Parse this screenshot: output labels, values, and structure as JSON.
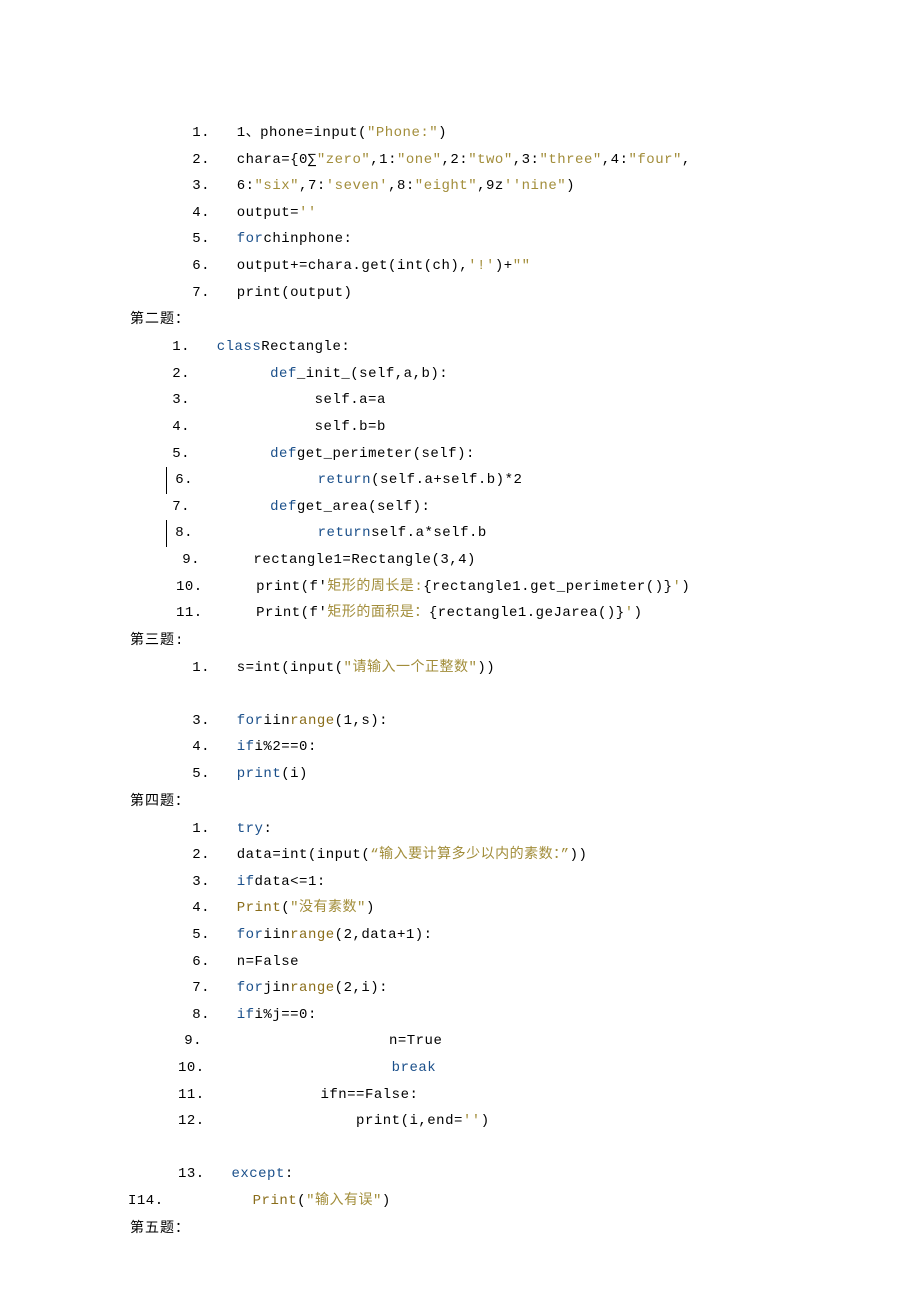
{
  "sections": [
    {
      "heading": null,
      "lines": [
        {
          "n": "1.",
          "indent": "ind0",
          "segs": [
            "1、phone=input(",
            {
              "cls": "str",
              "t": "\"Phone:\""
            },
            ")"
          ]
        },
        {
          "n": "2.",
          "indent": "ind0",
          "segs": [
            "chara={0∑",
            {
              "cls": "str",
              "t": "\"zero\""
            },
            ",1:",
            {
              "cls": "str",
              "t": "\"one\""
            },
            ",2:",
            {
              "cls": "str",
              "t": "\"two\""
            },
            ",3:",
            {
              "cls": "str",
              "t": "\"three\""
            },
            ",4:",
            {
              "cls": "str",
              "t": "\"four\""
            },
            ","
          ]
        },
        {
          "n": "3.",
          "indent": "ind0",
          "segs": [
            "6:",
            {
              "cls": "str",
              "t": "\"six\""
            },
            ",7:",
            {
              "cls": "str",
              "t": "'seven'"
            },
            ",8:",
            {
              "cls": "str",
              "t": "\"eight\""
            },
            ",9z",
            {
              "cls": "str",
              "t": "''nine\""
            },
            ")"
          ]
        },
        {
          "n": "4.",
          "indent": "ind0",
          "segs": [
            "output=",
            {
              "cls": "str",
              "t": "''"
            }
          ]
        },
        {
          "n": "5.",
          "indent": "ind0",
          "segs": [
            {
              "cls": "kw",
              "t": "for"
            },
            "chinphone:"
          ]
        },
        {
          "n": "6.",
          "indent": "ind0",
          "segs": [
            "output+=chara.get(int(ch),",
            {
              "cls": "str",
              "t": "'!'"
            },
            ")+",
            {
              "cls": "str",
              "t": "\"\""
            }
          ]
        },
        {
          "n": "7.",
          "indent": "ind0",
          "segs": [
            "print(output)"
          ]
        }
      ]
    },
    {
      "heading": "第二题：",
      "lines": [
        {
          "n": "1.",
          "indent": "ind0b",
          "segs": [
            {
              "cls": "kw",
              "t": "class"
            },
            "Rectangle:"
          ]
        },
        {
          "n": "2.",
          "indent": "ind0b",
          "segs": [
            "      ",
            {
              "cls": "kw",
              "t": "def"
            },
            "_init_(self,a,b):"
          ]
        },
        {
          "n": "3.",
          "indent": "ind0b",
          "segs": [
            "           self.a=a"
          ]
        },
        {
          "n": "4.",
          "indent": "ind0b",
          "segs": [
            "           self.b=b"
          ]
        },
        {
          "n": "5.",
          "indent": "ind0b",
          "segs": [
            "      ",
            {
              "cls": "kw",
              "t": "def"
            },
            "get_perimeter(self):"
          ]
        },
        {
          "n": "6.",
          "indent": "ind0b",
          "bar": true,
          "segs": [
            "           ",
            {
              "cls": "kw",
              "t": "return"
            },
            "(self.a+self.b)*2"
          ]
        },
        {
          "n": "7.",
          "indent": "ind0b",
          "segs": [
            "      ",
            {
              "cls": "kw",
              "t": "def"
            },
            "get_area(self):"
          ]
        },
        {
          "n": "8.",
          "indent": "ind0b",
          "bar": true,
          "segs": [
            "           ",
            {
              "cls": "kw",
              "t": "return"
            },
            "self.a*self.b"
          ]
        },
        {
          "n": "9.",
          "indent": "ind1",
          "segs": [
            "   rectangle1=Rectangle(3,4)"
          ]
        },
        {
          "n": "10.",
          "indent": "ind1",
          "segs": [
            "   print(f'",
            {
              "cls": "str",
              "t": "矩形的周长是:"
            },
            "{rectangle1.get_perimeter()}",
            {
              "cls": "str",
              "t": "'"
            },
            ")"
          ]
        },
        {
          "n": "11.",
          "indent": "ind1",
          "segs": [
            "   Print(f'",
            {
              "cls": "str",
              "t": "矩形的面积是："
            },
            "{rectangle1.geJarea()}",
            {
              "cls": "str",
              "t": "'"
            },
            ")"
          ]
        }
      ]
    },
    {
      "heading": "第三题:",
      "lines": [
        {
          "n": "1.",
          "indent": "ind0",
          "segs": [
            "s=int(input(",
            {
              "cls": "str",
              "t": "\"请输入一个正整数\""
            },
            "))"
          ],
          "nodot": true
        },
        {
          "n": "",
          "indent": "ind0",
          "segs": [
            ""
          ],
          "blank": true
        },
        {
          "n": "3.",
          "indent": "ind0",
          "segs": [
            {
              "cls": "kw",
              "t": "for"
            },
            "iin",
            {
              "cls": "fn",
              "t": "range"
            },
            "(1,s):"
          ]
        },
        {
          "n": "4.",
          "indent": "ind0",
          "segs": [
            {
              "cls": "kw",
              "t": "if"
            },
            "i%2==0:"
          ]
        },
        {
          "n": "5.",
          "indent": "ind0",
          "segs": [
            {
              "cls": "kw",
              "t": "print"
            },
            "(i)"
          ]
        }
      ]
    },
    {
      "heading": "第四题：",
      "lines": [
        {
          "n": "1.",
          "indent": "ind0",
          "segs": [
            {
              "cls": "kw",
              "t": "try"
            },
            ":"
          ]
        },
        {
          "n": "2.",
          "indent": "ind0",
          "segs": [
            "data=int(input(",
            {
              "cls": "str",
              "t": "“输入要计算多少以内的素数：”"
            },
            "))"
          ]
        },
        {
          "n": "3.",
          "indent": "ind0",
          "segs": [
            {
              "cls": "kw",
              "t": "if"
            },
            "data<=1:"
          ]
        },
        {
          "n": "4.",
          "indent": "ind0",
          "segs": [
            {
              "cls": "fn",
              "t": "Print"
            },
            "(",
            {
              "cls": "str",
              "t": "\"没有素数\""
            },
            ")"
          ]
        },
        {
          "n": "5.",
          "indent": "ind0",
          "segs": [
            {
              "cls": "kw",
              "t": "for"
            },
            "iin",
            {
              "cls": "fn",
              "t": "range"
            },
            "(2,data+1):"
          ]
        },
        {
          "n": "6.",
          "indent": "ind0",
          "segs": [
            "n=False"
          ]
        },
        {
          "n": "7.",
          "indent": "ind0",
          "segs": [
            {
              "cls": "kw",
              "t": "for"
            },
            "jin",
            {
              "cls": "fn",
              "t": "range"
            },
            "(2,i):"
          ]
        },
        {
          "n": "8.",
          "indent": "ind0",
          "segs": [
            {
              "cls": "kw",
              "t": "if"
            },
            "i%j==0:"
          ]
        },
        {
          "n": "9.",
          "indent": "ind3",
          "segs": [
            "                  n=True"
          ]
        },
        {
          "n": "10.",
          "indent": "ind3",
          "segs": [
            "                  ",
            {
              "cls": "kw",
              "t": "break"
            }
          ]
        },
        {
          "n": "11.",
          "indent": "ind3",
          "segs": [
            "          ifn==False:"
          ]
        },
        {
          "n": "12.",
          "indent": "ind3",
          "segs": [
            "              print(i,end=",
            {
              "cls": "str",
              "t": "''"
            },
            ")"
          ]
        },
        {
          "n": "",
          "indent": "ind0",
          "segs": [
            ""
          ],
          "blank": true
        },
        {
          "n": "13.",
          "indent": "ind3",
          "segs": [
            {
              "cls": "kw",
              "t": "except"
            },
            ":"
          ],
          "nodot": true
        },
        {
          "n": "I14.",
          "indent": "neg",
          "segs": [
            "       ",
            {
              "cls": "fn",
              "t": "Print"
            },
            "(",
            {
              "cls": "str",
              "t": "\"输入有误\""
            },
            ")"
          ]
        }
      ]
    },
    {
      "heading": "第五题：",
      "lines": []
    }
  ]
}
